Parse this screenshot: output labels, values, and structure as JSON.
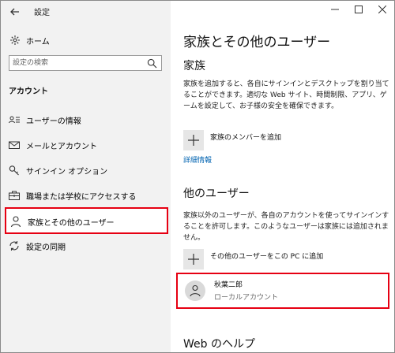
{
  "window": {
    "app_title": "設定"
  },
  "sidebar": {
    "home_label": "ホーム",
    "search_placeholder": "設定の検索",
    "section_label": "アカウント",
    "items": [
      {
        "label": "ユーザーの情報",
        "icon": "user-info-icon"
      },
      {
        "label": "メールとアカウント",
        "icon": "mail-icon"
      },
      {
        "label": "サインイン オプション",
        "icon": "key-icon"
      },
      {
        "label": "職場または学校にアクセスする",
        "icon": "briefcase-icon"
      },
      {
        "label": "家族とその他のユーザー",
        "icon": "person-icon",
        "active": true
      },
      {
        "label": "設定の同期",
        "icon": "sync-icon"
      }
    ]
  },
  "main": {
    "title": "家族とその他のユーザー",
    "family": {
      "heading": "家族",
      "description": "家族を追加すると、各自にサインインとデスクトップを割り当てることができます。適切な Web サイト、時間制限、アプリ、ゲームを設定して、お子様の安全を確保できます。",
      "add_label": "家族のメンバーを追加",
      "link": "詳細情報"
    },
    "other_users": {
      "heading": "他のユーザー",
      "description": "家族以外のユーザーが、各自のアカウントを使ってサインインすることを許可します。このようなユーザーは家族には追加されません。",
      "add_label": "その他のユーザーをこの PC に追加",
      "user_name": "秋葉二郎",
      "user_type": "ローカルアカウント"
    },
    "web_help_heading": "Web のヘルプ"
  },
  "colors": {
    "accent_link": "#0063b1",
    "highlight_red": "#e60012",
    "sidebar_bg": "#f2f2f2"
  }
}
